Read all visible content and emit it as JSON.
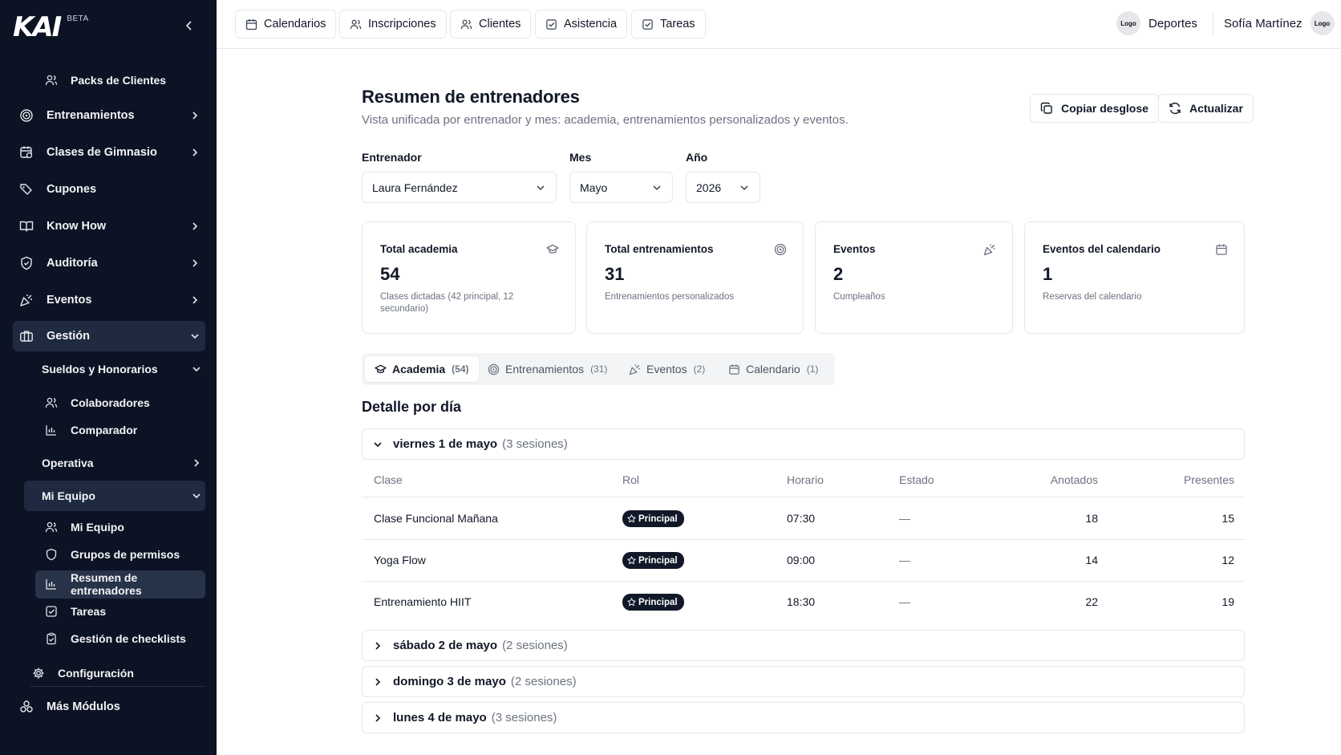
{
  "brand": {
    "logo": "KAI",
    "beta": "BETA"
  },
  "sidebar": {
    "packs": "Packs de Clientes",
    "entrenamientos": "Entrenamientos",
    "clases": "Clases de Gimnasio",
    "cupones": "Cupones",
    "knowhow": "Know How",
    "auditoria": "Auditoría",
    "eventos": "Eventos",
    "gestion": "Gestión",
    "sueldos": "Sueldos y Honorarios",
    "colaboradores": "Colaboradores",
    "comparador": "Comparador",
    "operativa": "Operativa",
    "miequipo_group": "Mi Equipo",
    "miequipo": "Mi Equipo",
    "grupos": "Grupos de permisos",
    "resumen": "Resumen de entrenadores",
    "tareas": "Tareas",
    "checklists": "Gestión de checklists",
    "configuracion": "Configuración",
    "mas": "Más Módulos"
  },
  "topnav": {
    "tabs": [
      "Calendarios",
      "Inscripciones",
      "Clientes",
      "Asistencia",
      "Tareas"
    ],
    "org_logo": "Logo",
    "org_name": "Deportes",
    "user_name": "Sofía Martínez",
    "user_logo": "Logo"
  },
  "page": {
    "title": "Resumen de entrenadores",
    "subtitle": "Vista unificada por entrenador y mes: academia, entrenamientos personalizados y eventos.",
    "copy_btn": "Copiar desglose",
    "refresh_btn": "Actualizar"
  },
  "filters": {
    "trainer_label": "Entrenador",
    "trainer_value": "Laura Fernández",
    "month_label": "Mes",
    "month_value": "Mayo",
    "year_label": "Año",
    "year_value": "2026"
  },
  "cards": [
    {
      "title": "Total academia",
      "value": "54",
      "desc": "Clases dictadas (42 principal, 12 secundario)",
      "icon": "graduation-cap-icon"
    },
    {
      "title": "Total entrenamientos",
      "value": "31",
      "desc": "Entrenamientos personalizados",
      "icon": "target-icon"
    },
    {
      "title": "Eventos",
      "value": "2",
      "desc": "Cumpleaños",
      "icon": "party-popper-icon"
    },
    {
      "title": "Eventos del calendario",
      "value": "1",
      "desc": "Reservas del calendario",
      "icon": "calendar-icon"
    }
  ],
  "segments": [
    {
      "label": "Academia",
      "count": "(54)"
    },
    {
      "label": "Entrenamientos",
      "count": "(31)"
    },
    {
      "label": "Eventos",
      "count": "(2)"
    },
    {
      "label": "Calendario",
      "count": "(1)"
    }
  ],
  "detail": {
    "heading": "Detalle por día",
    "columns": [
      "Clase",
      "Rol",
      "Horario",
      "Estado",
      "Anotados",
      "Presentes"
    ],
    "days": [
      {
        "name": "viernes 1 de mayo",
        "sessions": "(3 sesiones)"
      },
      {
        "name": "sábado 2 de mayo",
        "sessions": "(2 sesiones)"
      },
      {
        "name": "domingo 3 de mayo",
        "sessions": "(2 sesiones)"
      },
      {
        "name": "lunes 4 de mayo",
        "sessions": "(3 sesiones)"
      }
    ],
    "rows": [
      {
        "clase": "Clase Funcional Mañana",
        "rol": "Principal",
        "horario": "07:30",
        "estado": "—",
        "anotados": "18",
        "presentes": "15"
      },
      {
        "clase": "Yoga Flow",
        "rol": "Principal",
        "horario": "09:00",
        "estado": "—",
        "anotados": "14",
        "presentes": "12"
      },
      {
        "clase": "Entrenamiento HIIT",
        "rol": "Principal",
        "horario": "18:30",
        "estado": "—",
        "anotados": "22",
        "presentes": "19"
      }
    ]
  }
}
